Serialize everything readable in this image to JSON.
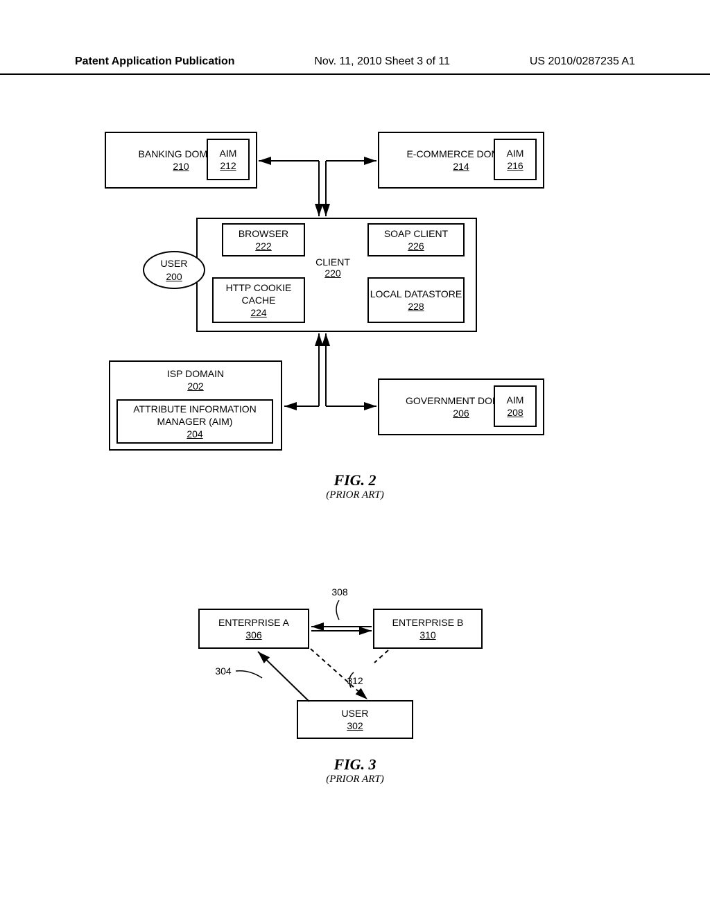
{
  "header": {
    "left": "Patent Application Publication",
    "center": "Nov. 11, 2010  Sheet 3 of 11",
    "right": "US 2010/0287235 A1"
  },
  "fig2": {
    "banking": {
      "title": "BANKING DOMAIN",
      "num": "210"
    },
    "banking_aim": {
      "title": "AIM",
      "num": "212"
    },
    "ecommerce": {
      "title": "E-COMMERCE DOMAIN",
      "num": "214"
    },
    "ecommerce_aim": {
      "title": "AIM",
      "num": "216"
    },
    "user": {
      "title": "USER",
      "num": "200"
    },
    "client": {
      "title": "CLIENT",
      "num": "220"
    },
    "browser": {
      "title": "BROWSER",
      "num": "222"
    },
    "cookie": {
      "title": "HTTP COOKIE CACHE",
      "num": "224"
    },
    "soap": {
      "title": "SOAP CLIENT",
      "num": "226"
    },
    "datastore": {
      "title": "LOCAL DATASTORE",
      "num": "228"
    },
    "isp": {
      "title": "ISP DOMAIN",
      "num": "202"
    },
    "aim_full": {
      "title": "ATTRIBUTE INFORMATION MANAGER (AIM)",
      "num": "204"
    },
    "gov": {
      "title": "GOVERNMENT DOMAIN",
      "num": "206"
    },
    "gov_aim": {
      "title": "AIM",
      "num": "208"
    },
    "caption": "FIG. 2",
    "subcaption": "(PRIOR ART)"
  },
  "fig3": {
    "entA": {
      "title": "ENTERPRISE A",
      "num": "306"
    },
    "entB": {
      "title": "ENTERPRISE B",
      "num": "310"
    },
    "user": {
      "title": "USER",
      "num": "302"
    },
    "ref308": "308",
    "ref304": "304",
    "ref312": "312",
    "caption": "FIG. 3",
    "subcaption": "(PRIOR ART)"
  }
}
